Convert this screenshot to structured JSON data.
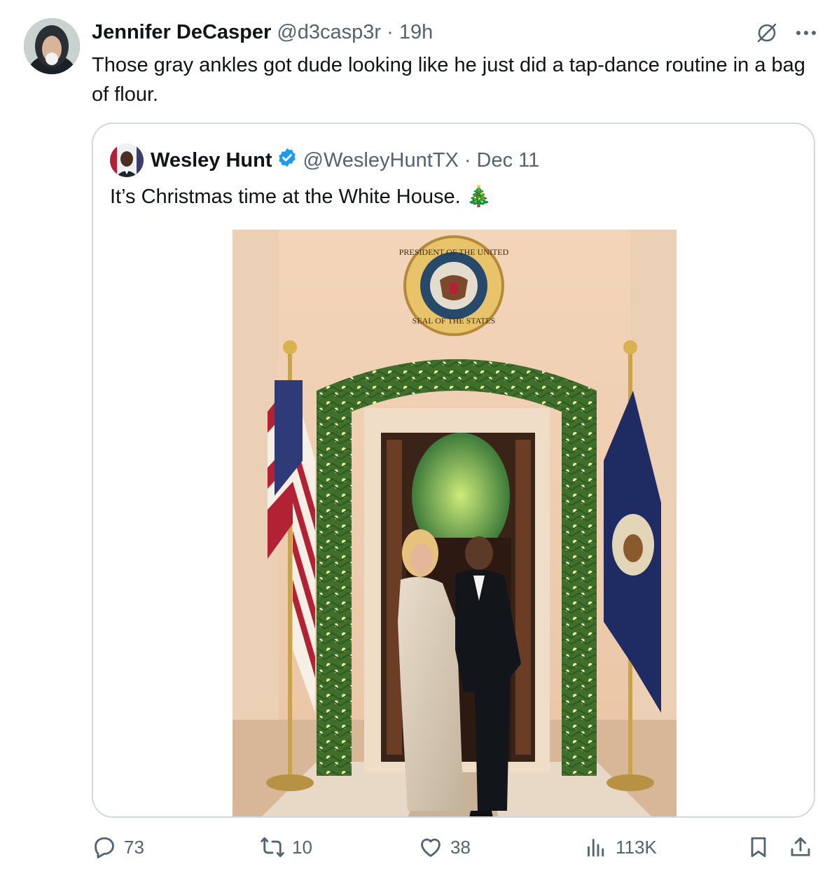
{
  "tweet": {
    "author_name": "Jennifer DeCasper",
    "handle": "@d3casp3r",
    "separator": "·",
    "time": "19h",
    "text": "Those gray ankles got dude looking like he just did a tap-dance routine in a bag of flour."
  },
  "quoted": {
    "author_name": "Wesley Hunt",
    "handle": "@WesleyHuntTX",
    "separator": "·",
    "date": "Dec 11",
    "text": "It’s Christmas time at the White House. 🎄",
    "photo": {
      "seal_top_text": "PRESIDENT OF THE UNITED",
      "seal_bottom_text": "SEAL OF THE STATES"
    }
  },
  "actions": {
    "reply_count": "73",
    "repost_count": "10",
    "like_count": "38",
    "view_count": "113K"
  },
  "icons": [
    "grok-icon",
    "more-icon",
    "reply-icon",
    "repost-icon",
    "like-icon",
    "views-icon",
    "bookmark-icon",
    "share-icon"
  ],
  "colors": {
    "text": "#0f1419",
    "secondary": "#536471",
    "border": "#cfd9de",
    "verified": "#1d9bf0"
  }
}
